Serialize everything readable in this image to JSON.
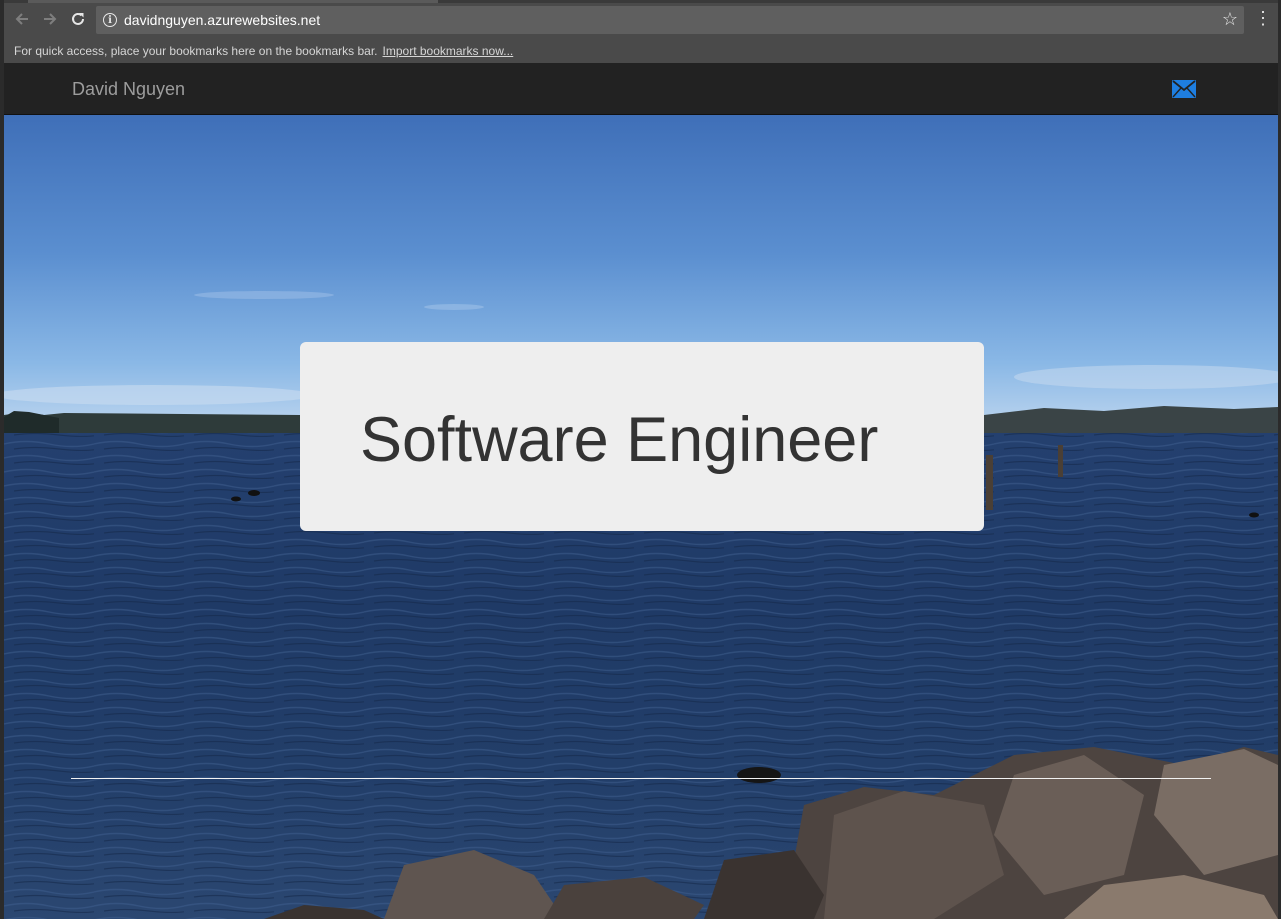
{
  "browser": {
    "url": "davidnguyen.azurewebsites.net",
    "bookmarks_bar": {
      "message": "For quick access, place your bookmarks here on the bookmarks bar.",
      "link": "Import bookmarks now..."
    },
    "icons": {
      "back": "arrow-left-icon",
      "forward": "arrow-right-icon",
      "reload": "reload-icon",
      "info": "info-icon",
      "bookmark": "star-icon",
      "menu": "kebab-menu-icon"
    }
  },
  "navbar": {
    "brand": "David Nguyen",
    "contact_icon": "envelope-icon",
    "background": "#222222",
    "accent": "#1e7ee0"
  },
  "hero": {
    "title": "Software Engineer",
    "background_image": "lake-shoreline-photo"
  }
}
